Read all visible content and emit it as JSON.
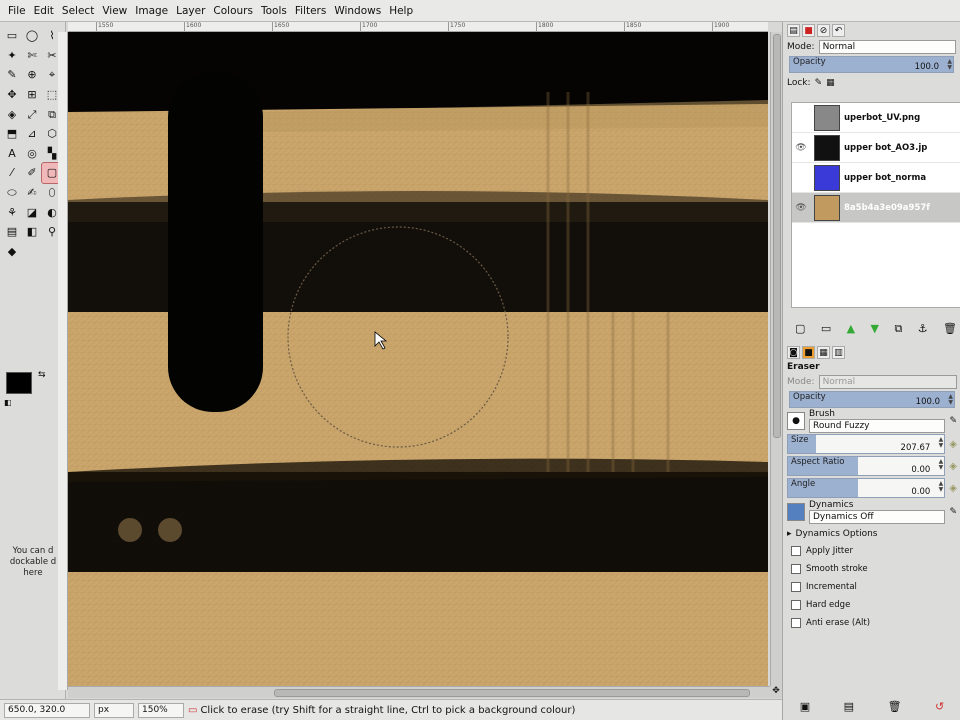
{
  "menu": [
    "File",
    "Edit",
    "Select",
    "View",
    "Image",
    "Layer",
    "Colours",
    "Tools",
    "Filters",
    "Windows",
    "Help"
  ],
  "toolbox": {
    "tools": [
      "▭",
      "◯",
      "⌇",
      "✦",
      "✄",
      "✂",
      "✎",
      "⊕",
      "⌖",
      "✥",
      "⊞",
      "⬚",
      "◈",
      "⤢",
      "⧉",
      "⬒",
      "⊿",
      "⬡",
      "A",
      "◎",
      "▚",
      "⁄",
      "✐",
      "▢",
      "⬭",
      "✍",
      "⬯",
      "⚘",
      "◪",
      "◐",
      "▤",
      "◧",
      "⚲",
      "◆"
    ],
    "active_index": 23,
    "dock_hint": "You can d dockable d here"
  },
  "ruler": [
    "1550",
    "1600",
    "1650",
    "1700",
    "1750",
    "1800",
    "1850",
    "1900"
  ],
  "status": {
    "coords": "650.0, 320.0",
    "unit": "px",
    "zoom": "150%",
    "message": "Click to erase (try Shift for a straight line, Ctrl to pick a background colour)"
  },
  "layers_panel": {
    "mode_label": "Mode:",
    "mode_value": "Normal",
    "opacity_label": "Opacity",
    "opacity_value": "100.0",
    "lock_label": "Lock:",
    "layers": [
      {
        "name": "uperbot_UV.png",
        "visible": false,
        "selected": false,
        "thumb": "#888"
      },
      {
        "name": "upper bot_AO3.jp",
        "visible": true,
        "selected": false,
        "thumb": "#111"
      },
      {
        "name": "upper bot_norma",
        "visible": false,
        "selected": false,
        "thumb": "#3a3ad8"
      },
      {
        "name": "8a5b4a3e09a957f",
        "visible": true,
        "selected": true,
        "thumb": "#c09a5e"
      }
    ]
  },
  "tool_options": {
    "title": "Eraser",
    "mode_label": "Mode:",
    "mode_value": "Normal",
    "opacity_label": "Opacity",
    "opacity_value": "100.0",
    "brush_label": "Brush",
    "brush_value": "Round Fuzzy",
    "size_label": "Size",
    "size_value": "207.67",
    "aspect_label": "Aspect Ratio",
    "aspect_value": "0.00",
    "angle_label": "Angle",
    "angle_value": "0.00",
    "dynamics_label": "Dynamics",
    "dynamics_value": "Dynamics Off",
    "dynamics_options": "Dynamics Options",
    "checks": [
      "Apply Jitter",
      "Smooth stroke",
      "Incremental",
      "Hard edge",
      "Anti erase  (Alt)"
    ]
  }
}
